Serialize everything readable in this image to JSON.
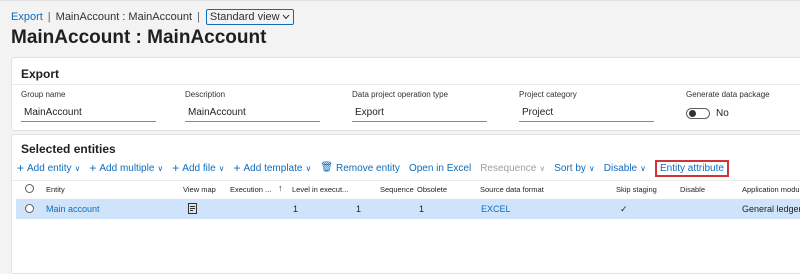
{
  "breadcrumb": {
    "export_link": "Export",
    "separator": "|",
    "current": "MainAccount : MainAccount",
    "view_select": "Standard view",
    "view_chevron_icon": "chevron-down-icon"
  },
  "page_title": "MainAccount : MainAccount",
  "export_section": {
    "title": "Export",
    "fields": {
      "group_name": {
        "label": "Group name",
        "value": "MainAccount"
      },
      "description": {
        "label": "Description",
        "value": "MainAccount"
      },
      "operation_type": {
        "label": "Data project operation type",
        "value": "Export"
      },
      "project_category": {
        "label": "Project category",
        "value": "Project"
      },
      "generate_package": {
        "label": "Generate data package",
        "value": "No",
        "on": false
      }
    }
  },
  "entities_section": {
    "title": "Selected entities",
    "toolbar": {
      "add_entity": "Add entity",
      "add_multiple": "Add multiple",
      "add_file": "Add file",
      "add_template": "Add template",
      "remove_entity": "Remove entity",
      "open_in_excel": "Open in Excel",
      "resequence": "Resequence",
      "sort_by": "Sort by",
      "disable": "Disable",
      "entity_attribute": "Entity attribute",
      "plus_icon": "+",
      "trash_icon": "🗑",
      "chevron_icon": "∨"
    },
    "columns": {
      "entity": "Entity",
      "view_map": "View map",
      "execution": "Execution ...",
      "sort_arrow": "↑",
      "level": "Level in execut...",
      "sequence": "Sequence",
      "obsolete": "Obsolete",
      "source_format": "Source data format",
      "skip_staging": "Skip staging",
      "disable": "Disable",
      "application_module": "Application modu"
    },
    "rows": [
      {
        "entity": "Main account",
        "view_map_icon": "map-document-icon",
        "execution": "1",
        "level": "1",
        "sequence": "1",
        "source_format": "EXCEL",
        "skip_staging": "✓",
        "application_module": "General ledger"
      }
    ]
  },
  "colors": {
    "accent": "#0f6cbd",
    "selected_row": "#cfe4fa",
    "highlight_box": "#d13438",
    "disabled_text": "#a19f9d"
  }
}
